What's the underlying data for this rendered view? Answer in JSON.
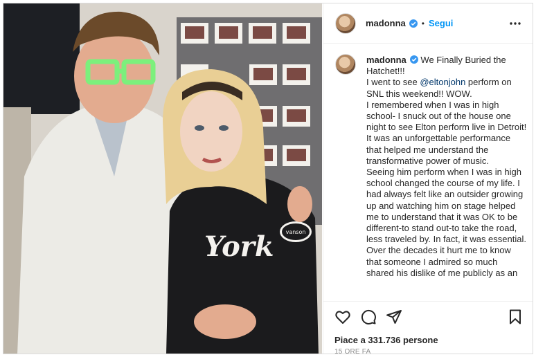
{
  "post": {
    "username": "madonna",
    "verified": true,
    "separator": "•",
    "follow_label": "Segui",
    "more_icon": "more-horizontal-icon"
  },
  "photo": {
    "subjects": [
      "man-in-white-suit-green-glasses",
      "woman-in-york-jacket"
    ],
    "jacket_text": "York",
    "patch_text": "vanson"
  },
  "caption": {
    "username": "madonna",
    "title": "We Finally Buried the Hatchet!!!",
    "line1_pre": "I went to see ",
    "mention": "@eltonjohn",
    "line1_post": " perform on SNL this weekend!! WOW.",
    "p2": "I remembered when I was in high school- I snuck out of the house one night to see Elton perform live in Detroit! It was an unforgettable performance that helped me understand the transformative power of music.",
    "p3": "Seeing him perform when I was in high school changed the course of my life. I had always felt like an outsider growing up and watching him on stage helped me to understand that it was OK to be different-to stand out-to take the road, less traveled by. In fact, it was essential.",
    "p4": "Over the decades it hurt me to know that someone I admired so much shared his dislike of me publicly as an"
  },
  "actions": {
    "icons": [
      "heart-icon",
      "comment-icon",
      "share-icon",
      "bookmark-icon"
    ],
    "likes_text": "Piace a 331.736 persone",
    "time_text": "15 ORE FA"
  },
  "colors": {
    "link": "#0095f6",
    "mention": "#00376b",
    "verified": "#3897f0"
  }
}
